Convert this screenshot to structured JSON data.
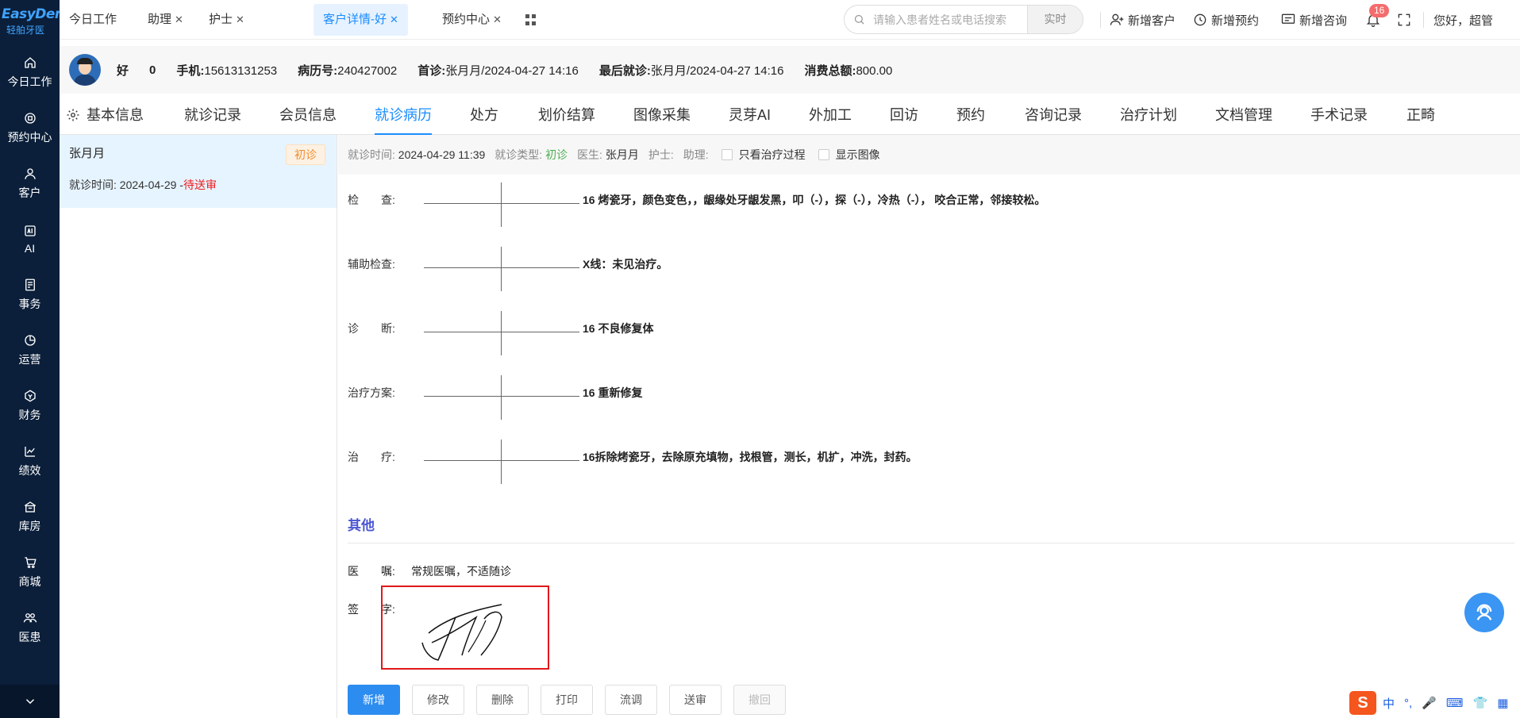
{
  "sidebar": {
    "brand": "EasyDent",
    "brand_sub": "轻舶牙医",
    "items": [
      {
        "label": "今日工作",
        "icon": "home-icon"
      },
      {
        "label": "预约中心",
        "icon": "appointment-icon"
      },
      {
        "label": "客户",
        "icon": "user-icon"
      },
      {
        "label": "AI",
        "icon": "ai-icon"
      },
      {
        "label": "事务",
        "icon": "task-icon"
      },
      {
        "label": "运营",
        "icon": "pie-chart-icon"
      },
      {
        "label": "财务",
        "icon": "finance-icon"
      },
      {
        "label": "绩效",
        "icon": "line-chart-icon"
      },
      {
        "label": "库房",
        "icon": "warehouse-icon"
      },
      {
        "label": "商城",
        "icon": "cart-icon"
      },
      {
        "label": "医患",
        "icon": "doctor-patient-icon"
      }
    ]
  },
  "tabs": [
    {
      "label": "今日工作",
      "closable": false
    },
    {
      "label": "助理",
      "closable": true
    },
    {
      "label": "护士",
      "closable": true
    },
    {
      "label": "客户详情-好",
      "closable": true,
      "active": true
    },
    {
      "label": "预约中心",
      "closable": true
    }
  ],
  "search": {
    "placeholder": "请输入患者姓名或电话搜索",
    "button": "实时"
  },
  "top_actions": {
    "new_customer": "新增客户",
    "new_appointment": "新增预约",
    "new_consult": "新增咨询",
    "notification_count": "16",
    "greeting": "您好，超管"
  },
  "patient": {
    "name": "好",
    "age": "0",
    "phone_label": "手机:",
    "phone": "15613131253",
    "record_label": "病历号:",
    "record_no": "240427002",
    "first_visit_label": "首诊:",
    "first_visit": "张月月/2024-04-27 14:16",
    "last_visit_label": "最后就诊:",
    "last_visit": "张月月/2024-04-27 14:16",
    "spend_label": "消费总额:",
    "spend": "800.00"
  },
  "section_tabs": [
    "基本信息",
    "就诊记录",
    "会员信息",
    "就诊病历",
    "处方",
    "划价结算",
    "图像采集",
    "灵芽AI",
    "外加工",
    "回访",
    "预约",
    "咨询记录",
    "治疗计划",
    "文档管理",
    "手术记录",
    "正畸"
  ],
  "record": {
    "doctor": "张月月",
    "type_tag": "初诊",
    "time_label": "就诊时间: 2024-04-29 -",
    "status": "待送审"
  },
  "infobar": {
    "time_label": "就诊时间:",
    "time": "2024-04-29 11:39",
    "type_label": "就诊类型:",
    "type": "初诊",
    "doctor_label": "医生:",
    "doctor": "张月月",
    "nurse_label": "护士:",
    "assistant_label": "助理:",
    "only_treatment": "只看治疗过程",
    "show_images": "显示图像"
  },
  "fields": [
    {
      "label": "检　　查:",
      "text": "16 烤瓷牙，颜色变色，，龈缘处牙龈发黑，叩（-），探（-），冷热（-）， 咬合正常，邻接较松。"
    },
    {
      "label": "辅助检查:",
      "text": "X线：未见治疗。"
    },
    {
      "label": "诊　　断:",
      "text": "16 不良修复体"
    },
    {
      "label": "治疗方案:",
      "text": "16 重新修复"
    },
    {
      "label": "治　　疗:",
      "text": "16拆除烤瓷牙，去除原充填物，找根管，测长，机扩，冲洗，封药。"
    }
  ],
  "other": {
    "title": "其他",
    "advice_label": "医　　嘱:",
    "advice": "常规医嘱，不适随诊",
    "sign_label": "签　　字:"
  },
  "buttons": [
    "新增",
    "修改",
    "删除",
    "打印",
    "流调",
    "送审",
    "撤回"
  ],
  "ime": {
    "logo": "S",
    "lang": "中",
    "punct": "°,"
  }
}
